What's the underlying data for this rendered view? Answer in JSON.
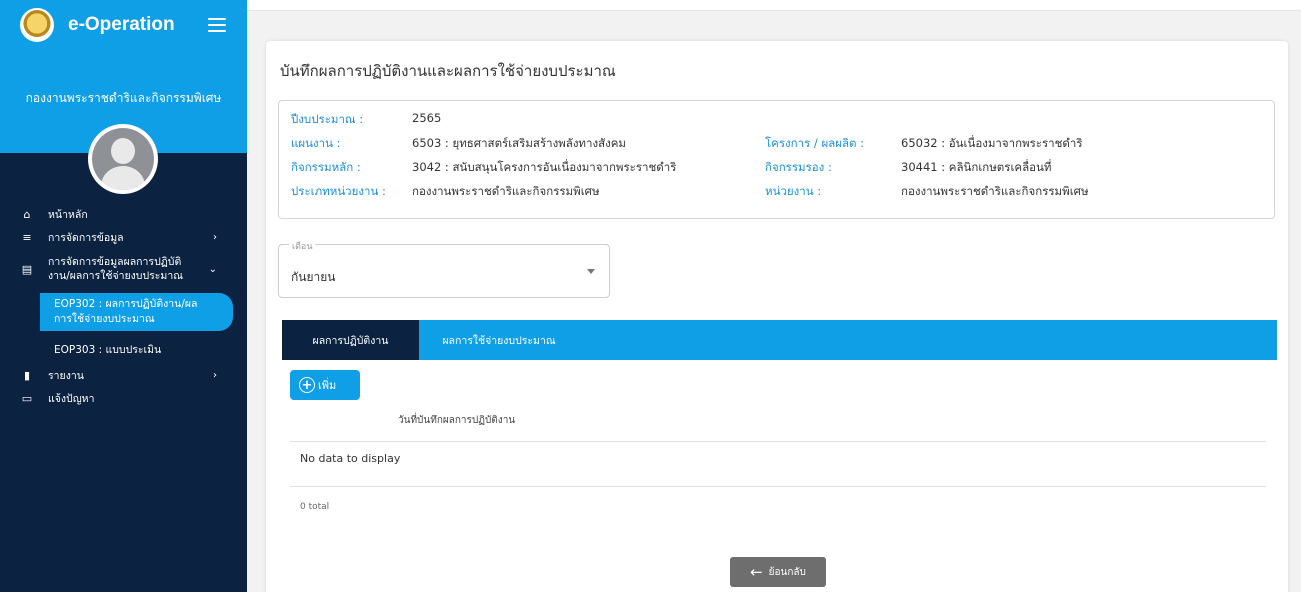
{
  "app": {
    "brand": "e-Operation",
    "org_name": "กองงานพระราชดำริและกิจกรรมพิเศษ"
  },
  "sidebar": {
    "items": [
      {
        "icon": "home-icon",
        "label": "หน้าหลัก"
      },
      {
        "icon": "list-icon",
        "label": "การจัดการข้อมูล"
      },
      {
        "icon": "document-icon",
        "label_line1": "การจัดการข้อมูลผลการปฏิบัติ",
        "label_line2": "งาน/ผลการใช้จ่ายงบประมาณ"
      },
      {
        "icon": "book-icon",
        "label": "รายงาน"
      },
      {
        "icon": "chat-icon",
        "label": "แจ้งปัญหา"
      }
    ],
    "sub_items": [
      {
        "label_line1": "EOP302 : ผลการปฏิบัติงาน/ผล",
        "label_line2": "การใช้จ่ายงบประมาณ"
      },
      {
        "label": "EOP303 : แบบประเมิน"
      }
    ]
  },
  "page": {
    "title": "บันทึกผลการปฏิบัติงานและผลการใช้จ่ายงบประมาณ",
    "info": {
      "fiscal_year_label": "ปีงบประมาณ :",
      "fiscal_year": "2565",
      "plan_label": "แผนงาน :",
      "plan": "6503 : ยุทธศาสตร์เสริมสร้างพลังทางสังคม",
      "project_label": "โครงการ / ผลผลิต :",
      "project": "65032 : อันเนื่องมาจากพระราชดำริ",
      "main_activity_label": "กิจกรรมหลัก :",
      "main_activity": "3042 : สนับสนุนโครงการอันเนื่องมาจากพระราชดำริ",
      "sub_activity_label": "กิจกรรมรอง :",
      "sub_activity": "30441 : คลินิกเกษตรเคลื่อนที่",
      "agency_type_label": "ประเภทหน่วยงาน :",
      "agency_type": "กองงานพระราชดำริและกิจกรรมพิเศษ",
      "agency_label": "หน่วยงาน :",
      "agency": "กองงานพระราชดำริและกิจกรรมพิเศษ"
    },
    "month_select": {
      "label": "เดือน",
      "value": "กันยายน"
    },
    "tabs": [
      {
        "label": "ผลการปฏิบัติงาน"
      },
      {
        "label": "ผลการใช้จ่ายงบประมาณ"
      }
    ],
    "add_label": "เพิ่ม",
    "column_header": "วันที่บันทึกผลการปฏิบัติงาน",
    "no_data": "No data to display",
    "total": "0 total",
    "back_label": "ย้อนกลับ"
  },
  "colors": {
    "primary": "#0e9fe6",
    "sidebar": "#0b2240",
    "label_blue": "#1c8fd8",
    "back_button": "#6e6e6e"
  }
}
